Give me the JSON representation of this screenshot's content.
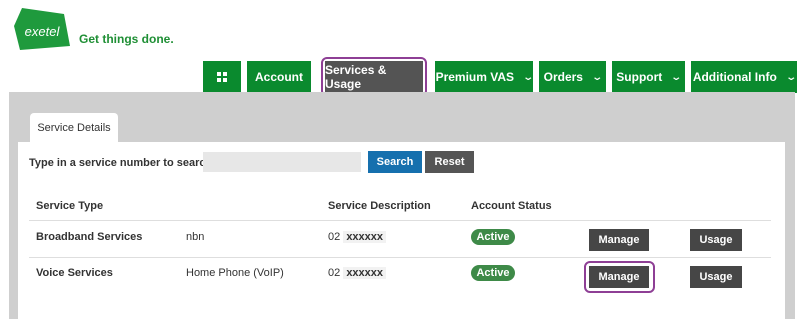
{
  "brand": {
    "logo_text": "exetel",
    "tagline": "Get things done."
  },
  "nav": {
    "account": "Account",
    "services_usage": "Services & Usage",
    "premium_vas": "Premium VAS",
    "orders": "Orders",
    "support": "Support",
    "additional_info": "Additional Info",
    "active_item": "Services & Usage"
  },
  "tab": {
    "label": "Service Details"
  },
  "search": {
    "label": "Type in a service number to search:",
    "value": "",
    "search_button": "Search",
    "reset_button": "Reset"
  },
  "table": {
    "headers": {
      "service_type": "Service Type",
      "service_description": "Service Description",
      "account_status": "Account Status"
    },
    "rows": [
      {
        "service_type": "Broadband Services",
        "plan": "nbn",
        "number_prefix": "02",
        "number_masked": "xxxxxx",
        "status": "Active",
        "manage": "Manage",
        "usage": "Usage"
      },
      {
        "service_type": "Voice Services",
        "plan": "Home Phone (VoIP)",
        "number_prefix": "02",
        "number_masked": "xxxxxx",
        "status": "Active",
        "manage": "Manage",
        "usage": "Usage"
      }
    ]
  },
  "colors": {
    "brand_green": "#0a8a2e",
    "active_nav": "#545454",
    "search_blue": "#1670ae",
    "status_green": "#3e8a48",
    "highlight_purple": "#8e3f95"
  }
}
